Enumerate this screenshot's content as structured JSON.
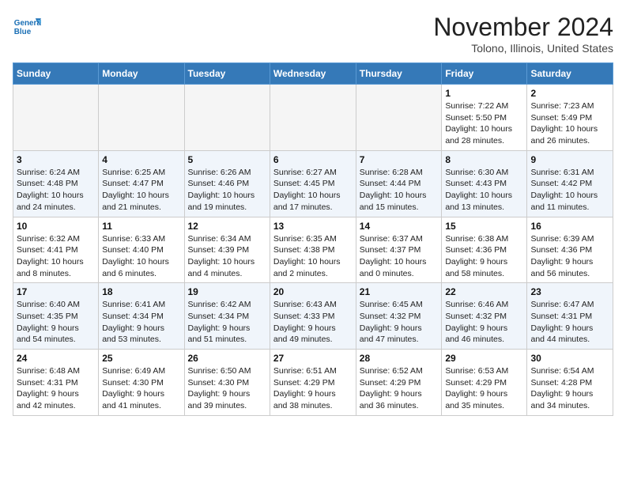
{
  "header": {
    "logo_line1": "General",
    "logo_line2": "Blue",
    "month_title": "November 2024",
    "location": "Tolono, Illinois, United States"
  },
  "calendar": {
    "days_of_week": [
      "Sunday",
      "Monday",
      "Tuesday",
      "Wednesday",
      "Thursday",
      "Friday",
      "Saturday"
    ],
    "weeks": [
      [
        {
          "day": "",
          "info": ""
        },
        {
          "day": "",
          "info": ""
        },
        {
          "day": "",
          "info": ""
        },
        {
          "day": "",
          "info": ""
        },
        {
          "day": "",
          "info": ""
        },
        {
          "day": "1",
          "info": "Sunrise: 7:22 AM\nSunset: 5:50 PM\nDaylight: 10 hours\nand 28 minutes."
        },
        {
          "day": "2",
          "info": "Sunrise: 7:23 AM\nSunset: 5:49 PM\nDaylight: 10 hours\nand 26 minutes."
        }
      ],
      [
        {
          "day": "3",
          "info": "Sunrise: 6:24 AM\nSunset: 4:48 PM\nDaylight: 10 hours\nand 24 minutes."
        },
        {
          "day": "4",
          "info": "Sunrise: 6:25 AM\nSunset: 4:47 PM\nDaylight: 10 hours\nand 21 minutes."
        },
        {
          "day": "5",
          "info": "Sunrise: 6:26 AM\nSunset: 4:46 PM\nDaylight: 10 hours\nand 19 minutes."
        },
        {
          "day": "6",
          "info": "Sunrise: 6:27 AM\nSunset: 4:45 PM\nDaylight: 10 hours\nand 17 minutes."
        },
        {
          "day": "7",
          "info": "Sunrise: 6:28 AM\nSunset: 4:44 PM\nDaylight: 10 hours\nand 15 minutes."
        },
        {
          "day": "8",
          "info": "Sunrise: 6:30 AM\nSunset: 4:43 PM\nDaylight: 10 hours\nand 13 minutes."
        },
        {
          "day": "9",
          "info": "Sunrise: 6:31 AM\nSunset: 4:42 PM\nDaylight: 10 hours\nand 11 minutes."
        }
      ],
      [
        {
          "day": "10",
          "info": "Sunrise: 6:32 AM\nSunset: 4:41 PM\nDaylight: 10 hours\nand 8 minutes."
        },
        {
          "day": "11",
          "info": "Sunrise: 6:33 AM\nSunset: 4:40 PM\nDaylight: 10 hours\nand 6 minutes."
        },
        {
          "day": "12",
          "info": "Sunrise: 6:34 AM\nSunset: 4:39 PM\nDaylight: 10 hours\nand 4 minutes."
        },
        {
          "day": "13",
          "info": "Sunrise: 6:35 AM\nSunset: 4:38 PM\nDaylight: 10 hours\nand 2 minutes."
        },
        {
          "day": "14",
          "info": "Sunrise: 6:37 AM\nSunset: 4:37 PM\nDaylight: 10 hours\nand 0 minutes."
        },
        {
          "day": "15",
          "info": "Sunrise: 6:38 AM\nSunset: 4:36 PM\nDaylight: 9 hours\nand 58 minutes."
        },
        {
          "day": "16",
          "info": "Sunrise: 6:39 AM\nSunset: 4:36 PM\nDaylight: 9 hours\nand 56 minutes."
        }
      ],
      [
        {
          "day": "17",
          "info": "Sunrise: 6:40 AM\nSunset: 4:35 PM\nDaylight: 9 hours\nand 54 minutes."
        },
        {
          "day": "18",
          "info": "Sunrise: 6:41 AM\nSunset: 4:34 PM\nDaylight: 9 hours\nand 53 minutes."
        },
        {
          "day": "19",
          "info": "Sunrise: 6:42 AM\nSunset: 4:34 PM\nDaylight: 9 hours\nand 51 minutes."
        },
        {
          "day": "20",
          "info": "Sunrise: 6:43 AM\nSunset: 4:33 PM\nDaylight: 9 hours\nand 49 minutes."
        },
        {
          "day": "21",
          "info": "Sunrise: 6:45 AM\nSunset: 4:32 PM\nDaylight: 9 hours\nand 47 minutes."
        },
        {
          "day": "22",
          "info": "Sunrise: 6:46 AM\nSunset: 4:32 PM\nDaylight: 9 hours\nand 46 minutes."
        },
        {
          "day": "23",
          "info": "Sunrise: 6:47 AM\nSunset: 4:31 PM\nDaylight: 9 hours\nand 44 minutes."
        }
      ],
      [
        {
          "day": "24",
          "info": "Sunrise: 6:48 AM\nSunset: 4:31 PM\nDaylight: 9 hours\nand 42 minutes."
        },
        {
          "day": "25",
          "info": "Sunrise: 6:49 AM\nSunset: 4:30 PM\nDaylight: 9 hours\nand 41 minutes."
        },
        {
          "day": "26",
          "info": "Sunrise: 6:50 AM\nSunset: 4:30 PM\nDaylight: 9 hours\nand 39 minutes."
        },
        {
          "day": "27",
          "info": "Sunrise: 6:51 AM\nSunset: 4:29 PM\nDaylight: 9 hours\nand 38 minutes."
        },
        {
          "day": "28",
          "info": "Sunrise: 6:52 AM\nSunset: 4:29 PM\nDaylight: 9 hours\nand 36 minutes."
        },
        {
          "day": "29",
          "info": "Sunrise: 6:53 AM\nSunset: 4:29 PM\nDaylight: 9 hours\nand 35 minutes."
        },
        {
          "day": "30",
          "info": "Sunrise: 6:54 AM\nSunset: 4:28 PM\nDaylight: 9 hours\nand 34 minutes."
        }
      ]
    ]
  }
}
